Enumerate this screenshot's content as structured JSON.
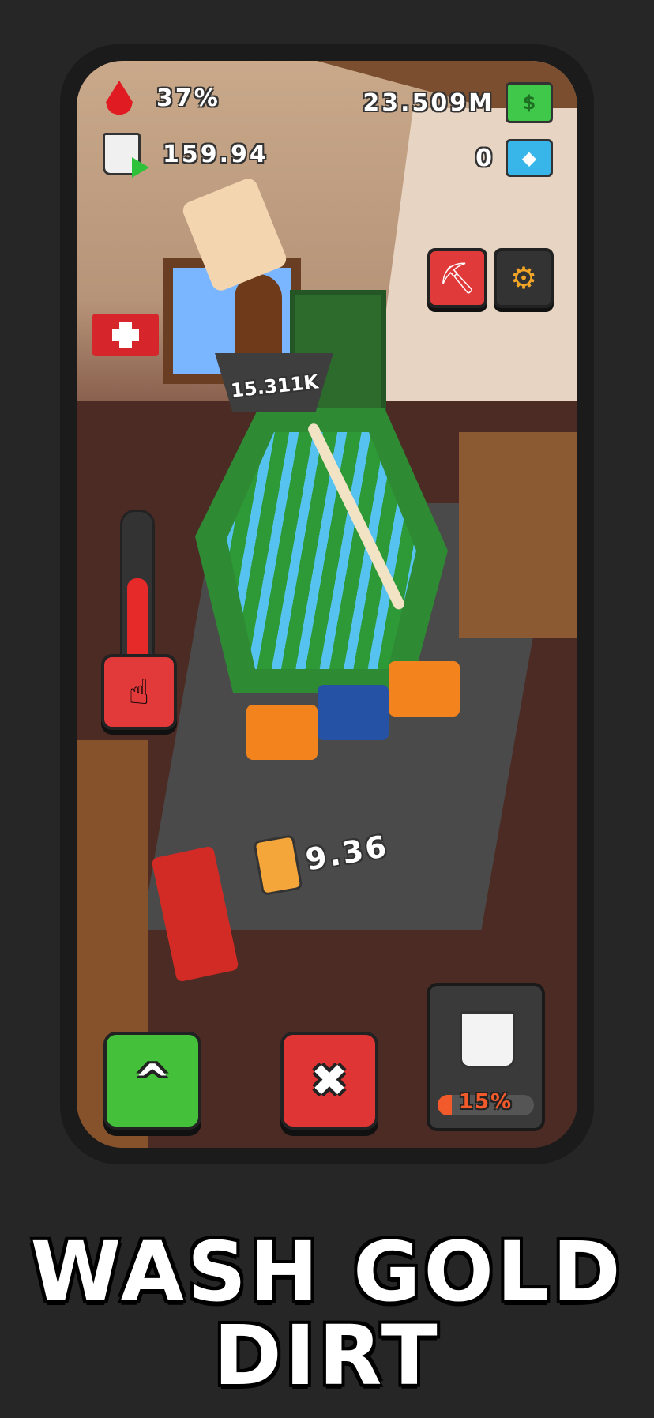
{
  "hud": {
    "water_percent": "37%",
    "bucket_count": "159.94",
    "cash": "23.509M",
    "gems": "0",
    "hopper_amount": "15.311K",
    "jar_amount": "9.36"
  },
  "controls": {
    "upgrade_label": "^",
    "cancel_label": "✖",
    "bucket_fill_percent": "15%",
    "bucket_fill_value": 0.15,
    "meter_level": 0.55
  },
  "icons": {
    "water": "droplet-icon",
    "bucket": "dirt-bucket-icon",
    "cash": "cash-icon",
    "gem": "diamond-icon",
    "pickaxe": "pickaxe-icon",
    "settings": "gear-icon",
    "tap": "tap-hand-icon",
    "jar": "gold-jar-icon"
  },
  "headline": {
    "line1": "WASH GOLD",
    "line2": "DIRT"
  },
  "colors": {
    "upgrade": "#45c03a",
    "cancel": "#e03535",
    "pickaxe": "#e03a3a",
    "settings": "#333333",
    "accent_orange": "#f35a2b"
  }
}
